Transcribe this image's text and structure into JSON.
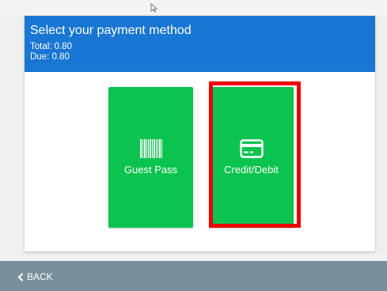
{
  "header": {
    "title": "Select your payment method",
    "total": "Total: 0.80",
    "due": "Due: 0.80"
  },
  "methods": [
    {
      "label": "Guest Pass",
      "icon": "barcode-icon"
    },
    {
      "label": "Credit/Debit",
      "icon": "credit-card-icon"
    }
  ],
  "footer": {
    "back_label": "BACK",
    "back_icon": "chevron-left-icon"
  },
  "colors": {
    "header": "#1976d2",
    "method_button": "#0bc34f",
    "highlight": "#ee0000",
    "footer": "#78909c"
  }
}
